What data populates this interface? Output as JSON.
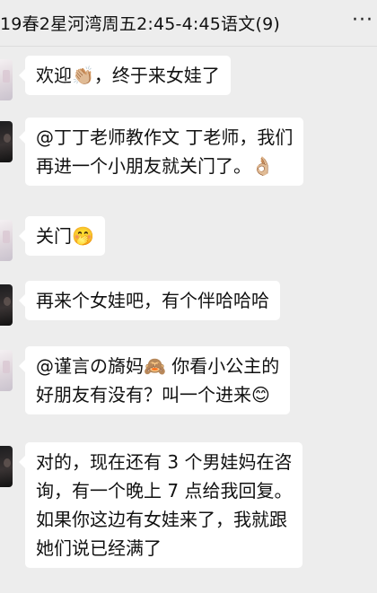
{
  "header": {
    "title": "19春2星河湾周五2:45-4:45语文(9)",
    "more_icon": "···"
  },
  "messages": [
    {
      "avatar": "light",
      "lines": [
        "欢迎👏🏼，终于来女娃了"
      ]
    },
    {
      "avatar": "dark",
      "lines": [
        "@丁丁老师教作文  丁老师，我们",
        "再进一个小朋友就关门了。👌🏼"
      ]
    },
    {
      "avatar": "light",
      "lines": [
        "关门🤭"
      ]
    },
    {
      "avatar": "dark",
      "lines": [
        "再来个女娃吧，有个伴哈哈哈"
      ]
    },
    {
      "avatar": "light",
      "lines": [
        "@谨言の旖妈🙈 你看小公主的",
        "好朋友有没有？叫一个进来😊"
      ]
    },
    {
      "avatar": "dark",
      "lines": [
        "对的，现在还有 3 个男娃妈在咨",
        "询，有一个晚上 7 点给我回复。",
        "如果你这边有女娃来了，我就跟",
        "她们说已经满了"
      ]
    }
  ]
}
